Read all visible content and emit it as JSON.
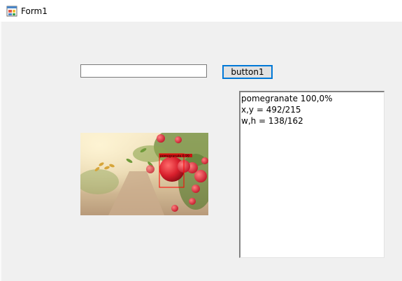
{
  "window": {
    "title": "Form1",
    "icon": "winforms-form-icon"
  },
  "input": {
    "value": "",
    "placeholder": ""
  },
  "button": {
    "label": "button1"
  },
  "image": {
    "subject": "pomegranate",
    "detection_label": "pomegranate 0.99"
  },
  "output": {
    "lines": [
      "pomegranate 100,0%",
      "x,y = 492/215",
      "w,h = 138/162"
    ]
  },
  "colors": {
    "accent": "#0078d7",
    "form_bg": "#f0f0f0",
    "detection_box": "#ff0000"
  }
}
